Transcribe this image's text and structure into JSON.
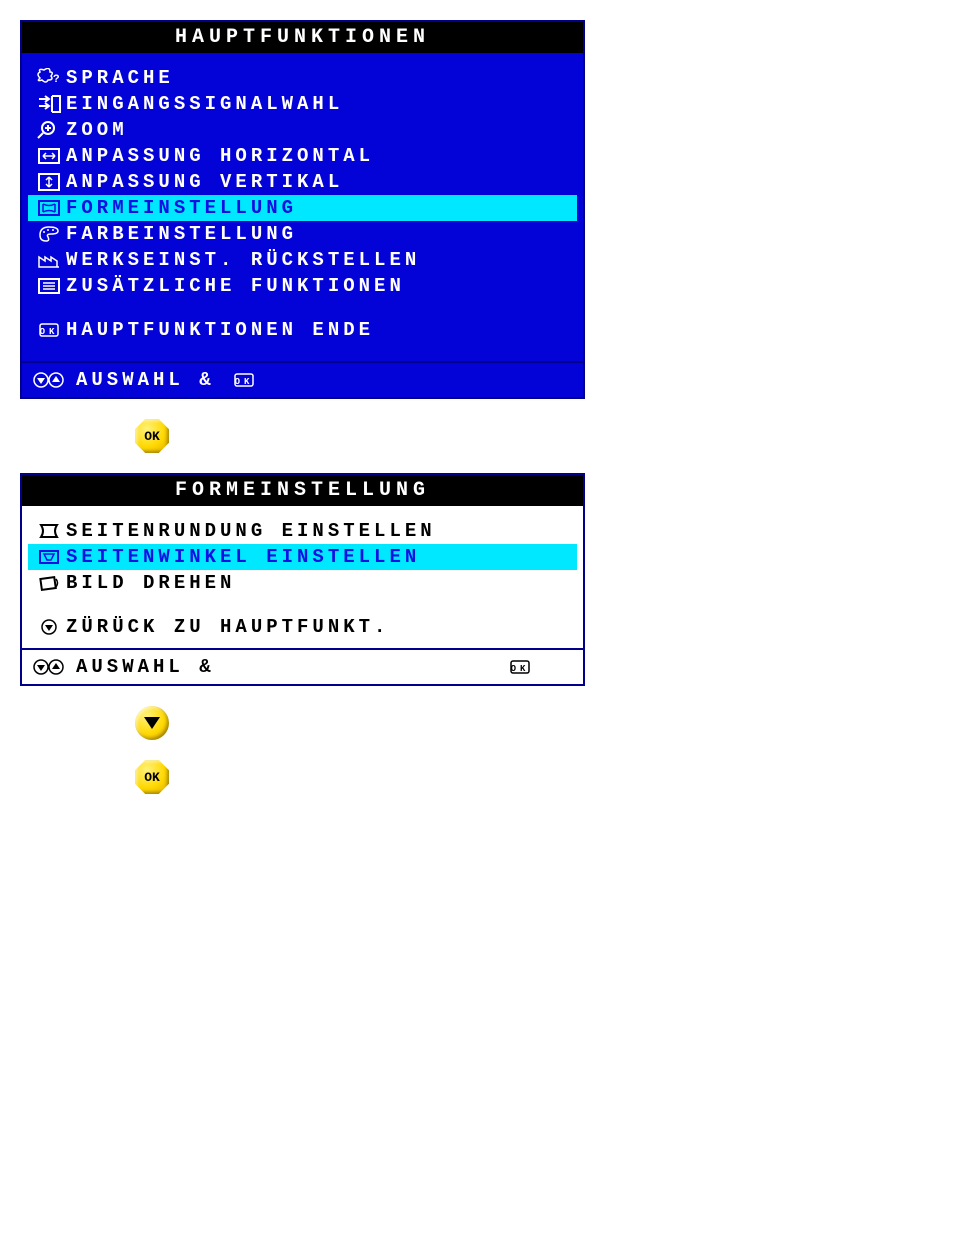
{
  "menu1": {
    "title": "HAUPTFUNKTIONEN",
    "items": [
      {
        "label": "SPRACHE"
      },
      {
        "label": "EINGANGSSIGNALWAHL"
      },
      {
        "label": "ZOOM"
      },
      {
        "label": "ANPASSUNG HORIZONTAL"
      },
      {
        "label": "ANPASSUNG VERTIKAL"
      },
      {
        "label": "FORMEINSTELLUNG"
      },
      {
        "label": "FARBEINSTELLUNG"
      },
      {
        "label": "WERKSEINST. RÜCKSTELLEN"
      },
      {
        "label": "ZUSÄTZLICHE FUNKTIONEN"
      }
    ],
    "exit": "HAUPTFUNKTIONEN ENDE",
    "footer": "AUSWAHL &",
    "selected_index": 5
  },
  "button1_label": "OK",
  "menu2": {
    "title": "FORMEINSTELLUNG",
    "items": [
      {
        "label": "SEITENRUNDUNG EINSTELLEN"
      },
      {
        "label": "SEITENWINKEL EINSTELLEN"
      },
      {
        "label": "BILD DREHEN"
      }
    ],
    "back": "ZÜRÜCK ZU HAUPTFUNKT.",
    "footer": "AUSWAHL &",
    "selected_index": 1
  },
  "button2_label": "",
  "button3_label": "OK"
}
